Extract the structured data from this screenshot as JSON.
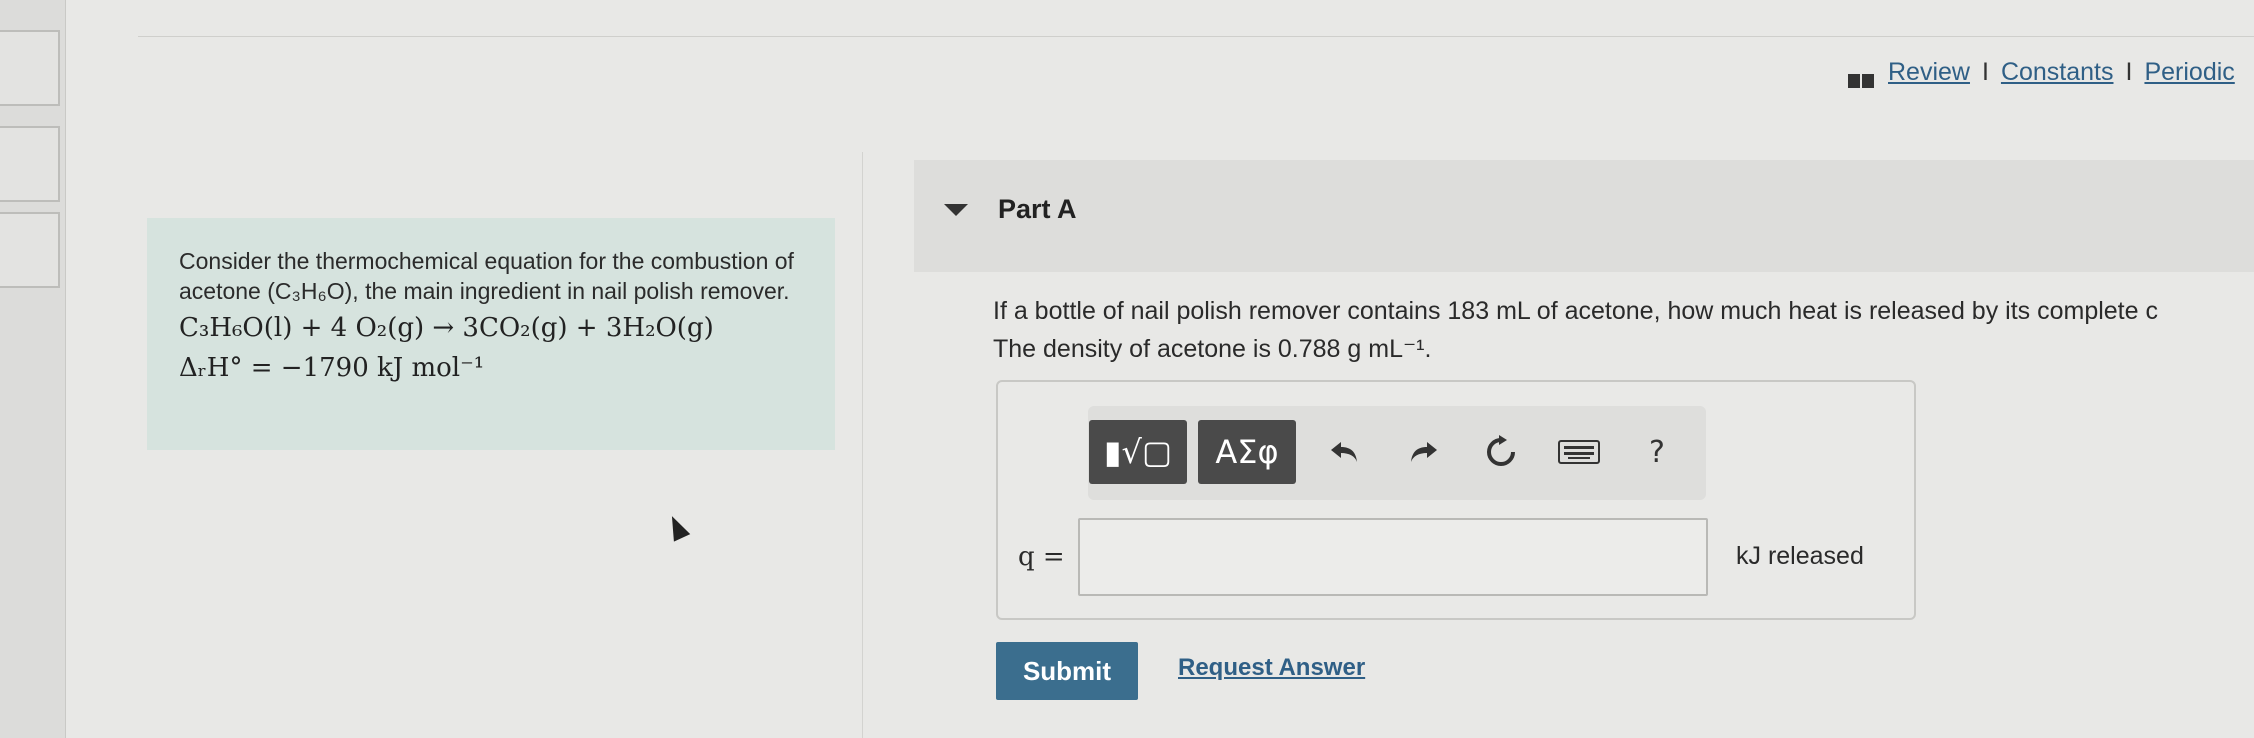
{
  "header": {
    "links": [
      "Review",
      "Constants",
      "Periodic"
    ],
    "separator": "I"
  },
  "problem": {
    "intro": "Consider the thermochemical equation for the combustion of acetone (C₃H₆O), the main ingredient in nail polish remover.",
    "equation": "C₃H₆O(l) + 4 O₂(g) → 3CO₂(g) + 3H₂O(g)",
    "enthalpy": "ΔᵣH° = −1790 kJ mol⁻¹"
  },
  "part": {
    "title": "Part A",
    "question_line1": "If a bottle of nail polish remover contains 183 mL of acetone, how much heat is released by its complete c",
    "question_line2": "The density of acetone is 0.788 g mL⁻¹."
  },
  "toolbar": {
    "template_button": "▮√▢",
    "greek_button": "ΑΣφ",
    "undo_icon": "undo-icon",
    "redo_icon": "redo-icon",
    "reset_icon": "reset-icon",
    "keyboard_icon": "keyboard-icon",
    "help_label": "?"
  },
  "answer": {
    "variable_label": "q =",
    "input_value": "",
    "unit_label": "kJ released"
  },
  "actions": {
    "submit_label": "Submit",
    "request_answer_label": "Request Answer"
  },
  "colors": {
    "accent": "#3b6e8e",
    "problem_bg": "#d6e3de",
    "toolbar_button": "#4a4a4a"
  }
}
